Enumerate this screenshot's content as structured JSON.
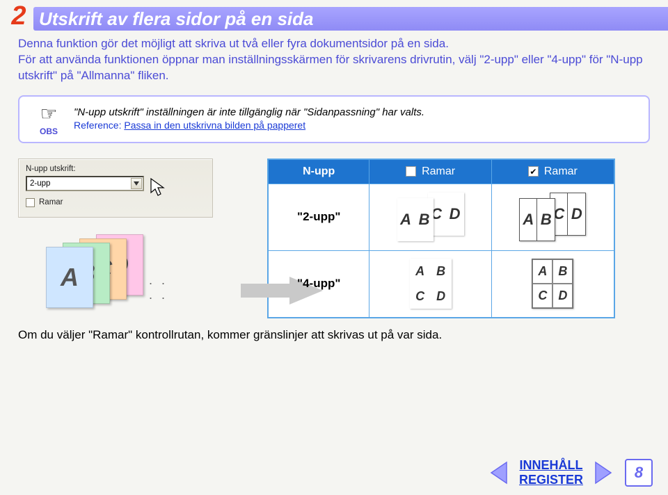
{
  "section_number": "2",
  "title": "Utskrift av flera sidor på en sida",
  "intro_p1": "Denna funktion gör det möjligt att skriva ut två eller fyra dokumentsidor på en sida.",
  "intro_p2": "För att använda funktionen öppnar man inställningsskärmen för skrivarens drivrutin, välj \"2-upp\" eller \"4-upp\" för \"N-upp utskrift\" på \"Allmanna\" fliken.",
  "note": {
    "obs": "OBS",
    "text": "\"N-upp utskrift\" inställningen är inte tillgänglig när \"Sidanpassning\" har valts.",
    "ref_prefix": "Reference: ",
    "ref_link": "Passa in den utskrivna bilden på papperet"
  },
  "dialog": {
    "label": "N-upp utskrift:",
    "value": "2-upp",
    "check_label": "Ramar"
  },
  "table": {
    "col1": "N-upp",
    "col2": "Ramar",
    "col3": "Ramar",
    "row1_label": "\"2-upp\"",
    "row2_label": "\"4-upp\""
  },
  "letters": {
    "A": "A",
    "B": "B",
    "C": "C",
    "D": "D"
  },
  "bottom_text": "Om du väljer \"Ramar\" kontrollrutan, kommer gränslinjer att skrivas ut på var sida.",
  "nav": {
    "contents": "INNEHÅLL",
    "register": "REGISTER"
  },
  "page_number": "8",
  "colors": {
    "docA": "#cfe6ff",
    "docB": "#b8ecc5",
    "docC": "#ffd6a8",
    "docD": "#ffc6e8"
  }
}
